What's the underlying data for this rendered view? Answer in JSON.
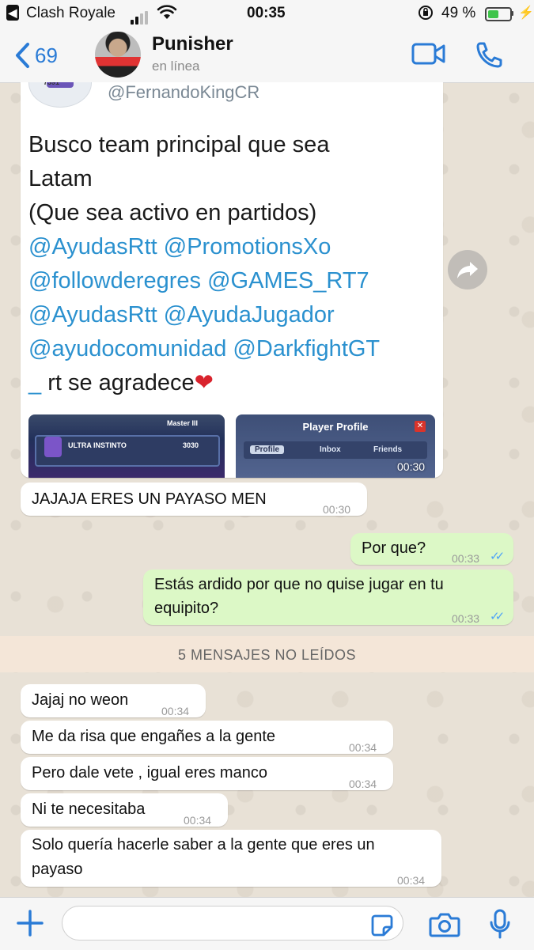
{
  "status_bar": {
    "back_glyph": "◀",
    "app_name": "Clash Royale",
    "time": "00:35",
    "battery_percent": "49 %",
    "battery_level": 0.49,
    "bolt": "⚡"
  },
  "header": {
    "back_count": "69",
    "contact_name": "Punisher",
    "contact_status": "en línea"
  },
  "tweet": {
    "avatar_badge": "7591",
    "handle": "@FernandoKingCR",
    "line1": "Busco team principal que sea",
    "line2": "Latam",
    "line3": "(Que sea activo en partidos)",
    "m1": "@AyudasRtt",
    "m2": "@PromotionsXo",
    "m3": "@followderegres",
    "m4": "@GAMES_RT7",
    "m5": "@AyudasRtt",
    "m6": "@AyudaJugador",
    "m7": "@ayudocomunidad",
    "m8": "@DarkfightGT",
    "tail_mention": "_",
    "tail_text": " rt se agradece",
    "heart": "❤",
    "img1_label": "ULTRA INSTINTO",
    "img1_rank": "Master III",
    "img1_trophies": "3030",
    "img2_title": "Player Profile",
    "img2_close": "✕",
    "img2_tab1": "Profile",
    "img2_tab2": "Inbox",
    "img2_tab3": "Friends",
    "time": "00:30"
  },
  "messages": [
    {
      "text": "JAJAJA ERES UN PAYASO MEN",
      "time": "00:30"
    },
    {
      "text": "Por que?",
      "time": "00:33",
      "ticks": "✓✓"
    },
    {
      "line1": "Estás ardido por que no quise jugar en tu",
      "line2": "equipito?",
      "time": "00:33",
      "ticks": "✓✓"
    },
    {
      "text": "Jajaj no weon",
      "time": "00:34"
    },
    {
      "text": "Me da risa que engañes a la gente",
      "time": "00:34"
    },
    {
      "text": "Pero dale vete , igual eres manco",
      "time": "00:34"
    },
    {
      "text": "Ni te necesitaba",
      "time": "00:34"
    },
    {
      "line1": "Solo quería hacerle saber a la gente que eres un",
      "line2": "payaso",
      "time": "00:34"
    }
  ],
  "unread_label": "5 MENSAJES NO LEÍDOS",
  "input": {
    "value": "",
    "placeholder": ""
  },
  "colors": {
    "accent": "#2a7bd6",
    "outgoing_bubble": "#dcf8c6",
    "incoming_bubble": "#ffffff",
    "read_ticks": "#4fa3f7",
    "mention": "#2b91cf",
    "unread_bar": "#f4e6d8"
  }
}
